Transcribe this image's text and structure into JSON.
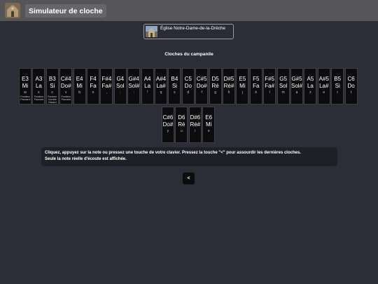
{
  "header": {
    "title": "Simulateur de cloche"
  },
  "church": {
    "name": "Église Notre-Dame-de-la-Drèche"
  },
  "section": {
    "title": "Cloches du campanile"
  },
  "keys_row1": [
    {
      "n1": "E3",
      "n2": "Mi",
      "kk": "w",
      "fd": "Fondeur Paccard"
    },
    {
      "n1": "A3",
      "n2": "La",
      "kk": "x",
      "fd": "Fondeur Paccard"
    },
    {
      "n1": "B3",
      "n2": "Si",
      "kk": "c",
      "fd": "Fondeur Cornille Havard"
    },
    {
      "n1": "C#4",
      "n2": "Do#",
      "kk": "v",
      "fd": "Fondeur Paccard"
    },
    {
      "n1": "E4",
      "n2": "Mi",
      "kk": "b",
      "fd": ""
    },
    {
      "n1": "F4",
      "n2": "Fa",
      "kk": "n",
      "fd": ""
    },
    {
      "n1": "F#4",
      "n2": "Fa#",
      "kk": ",",
      "fd": ""
    },
    {
      "n1": "G4",
      "n2": "Sol",
      "kk": ";",
      "fd": ""
    },
    {
      "n1": "G#4",
      "n2": "Sol#",
      "kk": ":",
      "fd": ""
    },
    {
      "n1": "A4",
      "n2": "La",
      "kk": "!",
      "fd": ""
    },
    {
      "n1": "A#4",
      "n2": "La#",
      "kk": "q",
      "fd": ""
    },
    {
      "n1": "B4",
      "n2": "Si",
      "kk": "s",
      "fd": ""
    },
    {
      "n1": "C5",
      "n2": "Do",
      "kk": "d",
      "fd": ""
    },
    {
      "n1": "C#5",
      "n2": "Do#",
      "kk": "f",
      "fd": ""
    },
    {
      "n1": "D5",
      "n2": "Ré",
      "kk": "g",
      "fd": ""
    },
    {
      "n1": "D#5",
      "n2": "Ré#",
      "kk": "h",
      "fd": ""
    },
    {
      "n1": "E5",
      "n2": "Mi",
      "kk": "j",
      "fd": ""
    },
    {
      "n1": "F5",
      "n2": "Fa",
      "kk": "k",
      "fd": ""
    },
    {
      "n1": "F#5",
      "n2": "Fa#",
      "kk": "l",
      "fd": ""
    },
    {
      "n1": "G5",
      "n2": "Sol",
      "kk": "m",
      "fd": ""
    },
    {
      "n1": "G#5",
      "n2": "Sol#",
      "kk": "a",
      "fd": ""
    },
    {
      "n1": "A5",
      "n2": "La",
      "kk": "z",
      "fd": ""
    },
    {
      "n1": "A#5",
      "n2": "La#",
      "kk": "e",
      "fd": ""
    },
    {
      "n1": "B5",
      "n2": "Si",
      "kk": "r",
      "fd": ""
    },
    {
      "n1": "C6",
      "n2": "Do",
      "kk": "t",
      "fd": ""
    }
  ],
  "keys_row2": [
    {
      "n1": "C#6",
      "n2": "Do#",
      "kk": "y",
      "fd": ""
    },
    {
      "n1": "D6",
      "n2": "Ré",
      "kk": "u",
      "fd": ""
    },
    {
      "n1": "D#6",
      "n2": "Ré#",
      "kk": "i",
      "fd": ""
    },
    {
      "n1": "E6",
      "n2": "Mi",
      "kk": "o",
      "fd": ""
    }
  ],
  "info": {
    "line1": "Cliquez, appuyez sur la note ou pressez une touche de votre clavier. Pressez la touche \"<\" pour assourdir les dernières cloches.",
    "line2": "Seule la note réelle d'écoute est affichée."
  },
  "back_button": {
    "label": "<"
  }
}
